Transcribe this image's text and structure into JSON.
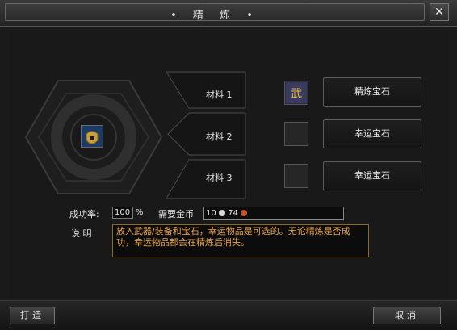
{
  "window": {
    "title": "• 精 炼 •",
    "close_label": "✕"
  },
  "materials": [
    {
      "label": "材料 1",
      "gem": "精炼宝石",
      "has_item": true
    },
    {
      "label": "材料 2",
      "gem": "幸运宝石",
      "has_item": false
    },
    {
      "label": "材料 3",
      "gem": "幸运宝石",
      "has_item": false
    }
  ],
  "slot_icon": "武",
  "stats": {
    "success_rate_label": "成功率:",
    "success_rate_value": "100",
    "percent_sign": "%",
    "gold_label": "需要金币",
    "gold_value_1": "10",
    "gold_value_2": "74"
  },
  "description": {
    "label": "说 明",
    "text": "放入武器/装备和宝石，幸运物品是可选的。无论精炼是否成功，幸运物品都会在精炼后消失。"
  },
  "buttons": {
    "craft": "打造",
    "cancel": "取消"
  },
  "colors": {
    "desc_text": "#e8a44b",
    "gold_coin": "#d8d8d8",
    "copper_coin": "#c0582c"
  }
}
